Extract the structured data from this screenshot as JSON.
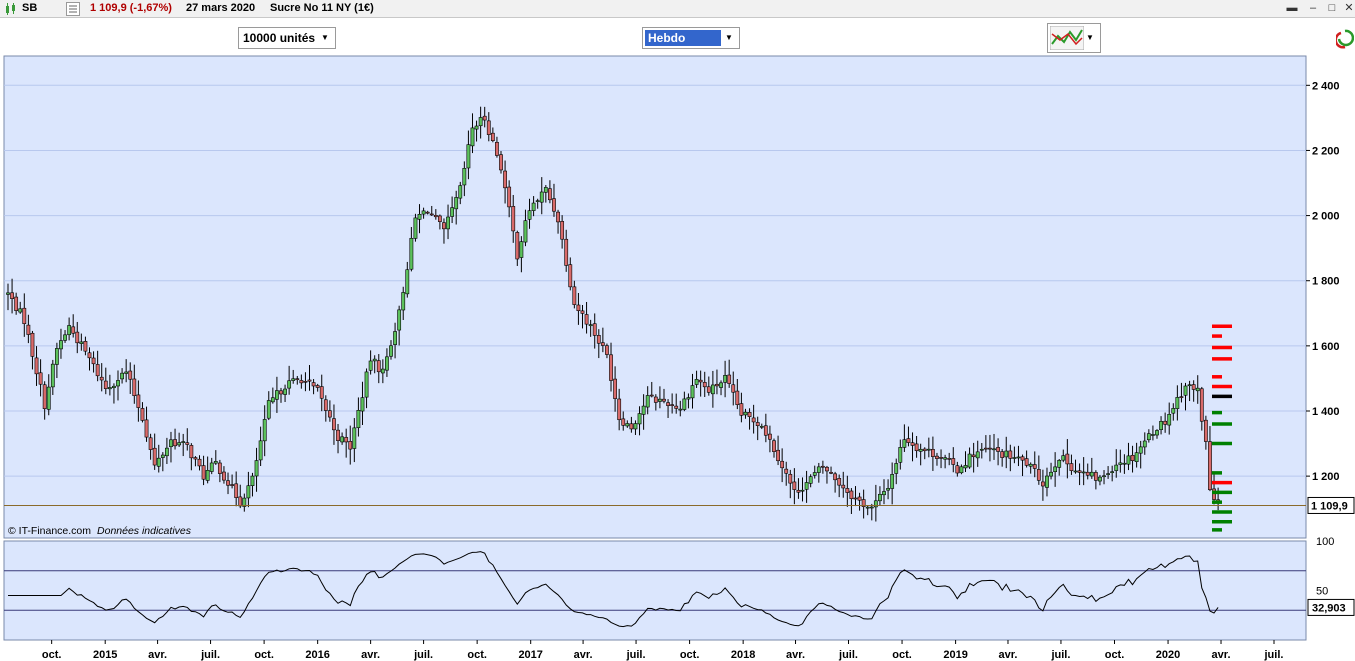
{
  "header": {
    "symbol": "SB",
    "price_change": "1 109,9 (-1,67%)",
    "date": "27 mars 2020",
    "instrument": "Sucre No 11 NY (1€)"
  },
  "toolbar": {
    "units_select": "10000 unités",
    "period_select": "Hebdo"
  },
  "colors": {
    "up": "#5cc15c",
    "down": "#d86a6a",
    "plot_bg": "#dbe6fd",
    "grid": "#b8c8ee",
    "last_price_line": "#8a6a2a"
  },
  "watermark": {
    "brand": "© IT-Finance.com",
    "note": "Données indicatives"
  },
  "chart_data": [
    {
      "type": "candlestick",
      "interval": "weekly",
      "y_ticks": [
        "2 400",
        "2 200",
        "2 000",
        "1 800",
        "1 600",
        "1 400",
        "1 200"
      ],
      "y_tick_values": [
        2400,
        2200,
        2000,
        1800,
        1600,
        1400,
        1200
      ],
      "ylim": [
        1010,
        2490
      ],
      "last_value": 1109.9,
      "last_label": "1 109,9",
      "x_labels": [
        "oct.",
        "2015",
        "avr.",
        "juil.",
        "oct.",
        "2016",
        "avr.",
        "juil.",
        "oct.",
        "2017",
        "avr.",
        "juil.",
        "oct.",
        "2018",
        "avr.",
        "juil.",
        "oct.",
        "2019",
        "avr.",
        "juil.",
        "oct.",
        "2020",
        "avr.",
        "juil."
      ],
      "x_label_dates": [
        "2014-10-01",
        "2015-01-01",
        "2015-04-01",
        "2015-07-01",
        "2015-10-01",
        "2016-01-01",
        "2016-04-01",
        "2016-07-01",
        "2016-10-01",
        "2017-01-01",
        "2017-04-01",
        "2017-07-01",
        "2017-10-01",
        "2018-01-01",
        "2018-04-01",
        "2018-07-01",
        "2018-10-01",
        "2019-01-01",
        "2019-04-01",
        "2019-07-01",
        "2019-10-01",
        "2020-01-01",
        "2020-04-01",
        "2020-07-01"
      ],
      "x_major": [
        "2015",
        "2016",
        "2017",
        "2018",
        "2019",
        "2020"
      ],
      "close_anchors": [
        [
          "2014-07-18",
          1760
        ],
        [
          "2014-08-15",
          1680
        ],
        [
          "2014-09-19",
          1420
        ],
        [
          "2014-10-10",
          1590
        ],
        [
          "2014-10-31",
          1660
        ],
        [
          "2014-12-05",
          1560
        ],
        [
          "2015-01-02",
          1470
        ],
        [
          "2015-02-06",
          1520
        ],
        [
          "2015-03-06",
          1380
        ],
        [
          "2015-03-27",
          1230
        ],
        [
          "2015-04-24",
          1310
        ],
        [
          "2015-05-22",
          1290
        ],
        [
          "2015-06-19",
          1200
        ],
        [
          "2015-07-10",
          1240
        ],
        [
          "2015-08-21",
          1120
        ],
        [
          "2015-09-11",
          1190
        ],
        [
          "2015-10-09",
          1420
        ],
        [
          "2015-11-06",
          1480
        ],
        [
          "2015-12-04",
          1500
        ],
        [
          "2016-01-01",
          1460
        ],
        [
          "2016-02-05",
          1320
        ],
        [
          "2016-02-26",
          1290
        ],
        [
          "2016-04-01",
          1560
        ],
        [
          "2016-04-22",
          1520
        ],
        [
          "2016-05-20",
          1700
        ],
        [
          "2016-06-17",
          1990
        ],
        [
          "2016-07-08",
          2020
        ],
        [
          "2016-08-05",
          1950
        ],
        [
          "2016-09-02",
          2080
        ],
        [
          "2016-09-23",
          2270
        ],
        [
          "2016-10-14",
          2300
        ],
        [
          "2016-11-11",
          2150
        ],
        [
          "2016-12-09",
          1880
        ],
        [
          "2016-12-30",
          2020
        ],
        [
          "2017-01-27",
          2080
        ],
        [
          "2017-02-17",
          1990
        ],
        [
          "2017-03-17",
          1730
        ],
        [
          "2017-04-14",
          1660
        ],
        [
          "2017-05-12",
          1570
        ],
        [
          "2017-06-02",
          1380
        ],
        [
          "2017-06-23",
          1350
        ],
        [
          "2017-07-21",
          1440
        ],
        [
          "2017-08-18",
          1430
        ],
        [
          "2017-09-15",
          1410
        ],
        [
          "2017-10-13",
          1500
        ],
        [
          "2017-11-03",
          1460
        ],
        [
          "2017-12-01",
          1500
        ],
        [
          "2017-12-29",
          1390
        ],
        [
          "2018-02-02",
          1360
        ],
        [
          "2018-03-02",
          1260
        ],
        [
          "2018-03-30",
          1150
        ],
        [
          "2018-04-20",
          1180
        ],
        [
          "2018-05-18",
          1230
        ],
        [
          "2018-06-15",
          1180
        ],
        [
          "2018-07-13",
          1130
        ],
        [
          "2018-08-10",
          1100
        ],
        [
          "2018-09-07",
          1170
        ],
        [
          "2018-10-05",
          1320
        ],
        [
          "2018-10-26",
          1290
        ],
        [
          "2018-12-07",
          1260
        ],
        [
          "2019-01-04",
          1220
        ],
        [
          "2019-02-01",
          1270
        ],
        [
          "2019-03-01",
          1280
        ],
        [
          "2019-04-05",
          1260
        ],
        [
          "2019-05-03",
          1240
        ],
        [
          "2019-05-31",
          1180
        ],
        [
          "2019-06-28",
          1260
        ],
        [
          "2019-08-02",
          1210
        ],
        [
          "2019-09-06",
          1190
        ],
        [
          "2019-10-04",
          1240
        ],
        [
          "2019-11-01",
          1260
        ],
        [
          "2019-12-06",
          1340
        ],
        [
          "2019-12-27",
          1370
        ],
        [
          "2020-01-31",
          1480
        ],
        [
          "2020-02-21",
          1460
        ],
        [
          "2020-03-06",
          1300
        ],
        [
          "2020-03-13",
          1160
        ],
        [
          "2020-03-20",
          1128
        ],
        [
          "2020-03-27",
          1109.9
        ]
      ],
      "markers": [
        {
          "value": 1660,
          "color": "#ff0000"
        },
        {
          "value": 1630,
          "color": "#ff0000"
        },
        {
          "value": 1595,
          "color": "#ff0000"
        },
        {
          "value": 1560,
          "color": "#ff0000"
        },
        {
          "value": 1505,
          "color": "#ff0000"
        },
        {
          "value": 1475,
          "color": "#ff0000"
        },
        {
          "value": 1445,
          "color": "#000000"
        },
        {
          "value": 1395,
          "color": "#008000"
        },
        {
          "value": 1360,
          "color": "#008000"
        },
        {
          "value": 1300,
          "color": "#008000"
        },
        {
          "value": 1210,
          "color": "#008000"
        },
        {
          "value": 1180,
          "color": "#ff0000"
        },
        {
          "value": 1150,
          "color": "#008000"
        },
        {
          "value": 1120,
          "color": "#008000"
        },
        {
          "value": 1090,
          "color": "#008000"
        },
        {
          "value": 1060,
          "color": "#008000"
        },
        {
          "value": 1035,
          "color": "#008000"
        }
      ]
    },
    {
      "type": "line",
      "y_ticks": [
        "100",
        "50"
      ],
      "y_tick_values": [
        100,
        50
      ],
      "ylim": [
        0,
        100
      ],
      "levels": [
        70,
        30
      ],
      "last_value": 32.903,
      "last_label": "32,903"
    }
  ]
}
